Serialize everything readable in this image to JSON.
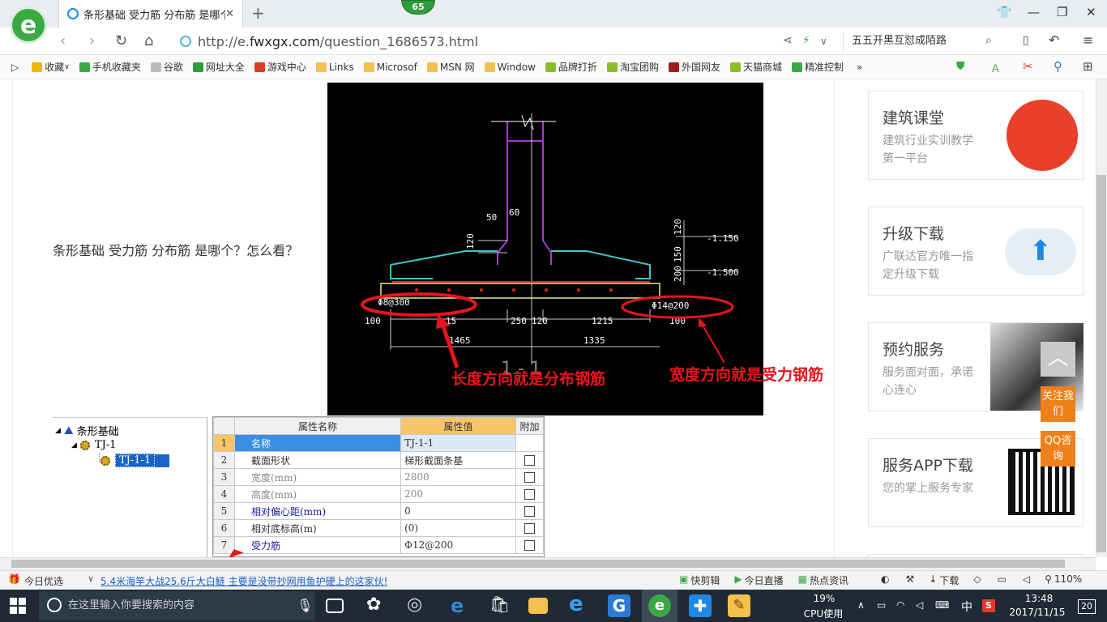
{
  "browser": {
    "tab_title": "条形基础 受力筋 分布筋 是哪个？怎",
    "tab_close": "✕",
    "new_tab": "+",
    "badge": "65",
    "url_prefix": "http://e.",
    "url_domain": "fwxgx.com",
    "url_path": "/question_1686573.html",
    "search_text": "五五开黑互怼成陌路",
    "logo": "e"
  },
  "bookmarks": [
    {
      "label": "收藏",
      "icon": "star-icon",
      "color": "#f0b400"
    },
    {
      "label": "手机收藏夹",
      "icon": "phone-icon",
      "color": "#3aa944"
    },
    {
      "label": "谷歌",
      "icon": "page-icon",
      "color": "#bbbbbb"
    },
    {
      "label": "网址大全",
      "icon": "globe-icon",
      "color": "#2e9b3c"
    },
    {
      "label": "游戏中心",
      "icon": "game-icon",
      "color": "#e03a2a"
    },
    {
      "label": "Links",
      "icon": "folder-icon",
      "color": "#f2c14e"
    },
    {
      "label": "Microsof",
      "icon": "folder-icon",
      "color": "#f2c14e"
    },
    {
      "label": "MSN 网",
      "icon": "folder-icon",
      "color": "#f2c14e"
    },
    {
      "label": "Window",
      "icon": "folder-icon",
      "color": "#f2c14e"
    },
    {
      "label": "品牌打折",
      "icon": "leaf-icon",
      "color": "#8bbf2a"
    },
    {
      "label": "淘宝团购",
      "icon": "leaf-icon",
      "color": "#8bbf2a"
    },
    {
      "label": "外国网友",
      "icon": "flag-icon",
      "color": "#a01a1a"
    },
    {
      "label": "天猫商城",
      "icon": "leaf-icon",
      "color": "#8bbf2a"
    },
    {
      "label": "精准控制",
      "icon": "chat-icon",
      "color": "#3aa944"
    }
  ],
  "question": "条形基础 受力筋 分布筋 是哪个？怎么看？",
  "annotations": {
    "length_dir": "长度方向就是分布钢筋",
    "width_dir": "宽度方向就是受力钢筋"
  },
  "cad_labels": {
    "rebar_left": "Φ8@300",
    "rebar_right": "Φ14@200",
    "elev1": "-1.150",
    "elev2": "-1.500",
    "dim_50": "50",
    "dim_60": "60",
    "dim_120": "120",
    "dim_250": "250",
    "dim_1215": "1215",
    "dim_1335": "1335",
    "dim_1465": "1465",
    "dim_100": "100",
    "dim_150": "150",
    "dim_200": "200",
    "dim_15": "15"
  },
  "tree": {
    "root": "条形基础",
    "child": "TJ-1",
    "leaf": "TJ-1-1"
  },
  "prop_table": {
    "headers": [
      "属性名称",
      "属性值",
      "附加"
    ],
    "rows": [
      {
        "n": "1",
        "name": "名称",
        "value": "TJ-1-1",
        "style": "blue",
        "check": false
      },
      {
        "n": "2",
        "name": "截面形状",
        "value": "梯形截面条基",
        "style": "",
        "check": true
      },
      {
        "n": "3",
        "name": "宽度(mm)",
        "value": "2800",
        "style": "gray",
        "check": true
      },
      {
        "n": "4",
        "name": "高度(mm)",
        "value": "200",
        "style": "gray",
        "check": true
      },
      {
        "n": "5",
        "name": "相对偏心距(mm)",
        "value": "0",
        "style": "blue",
        "check": true
      },
      {
        "n": "6",
        "name": "相对底标高(m)",
        "value": "(0)",
        "style": "",
        "check": true
      },
      {
        "n": "7",
        "name": "受力筋",
        "value": "Φ12@200",
        "style": "blue",
        "check": true
      }
    ]
  },
  "sidebar": [
    {
      "title": "建筑课堂",
      "sub": "建筑行业实训教学第一平台",
      "icon": "brand-swirl-icon"
    },
    {
      "title": "升级下载",
      "sub": "广联达官方唯一指定升级下载",
      "icon": "cloud-upload-icon"
    },
    {
      "title": "预约服务",
      "sub": "服务面对面，承诺心连心",
      "icon": "businessman-icon"
    },
    {
      "title": "服务APP下载",
      "sub": "您的掌上服务专家",
      "icon": "qr-code-icon"
    }
  ],
  "float": {
    "backtop": "︿",
    "follow": "关注我们",
    "qq": "QQ咨询"
  },
  "statusbar": {
    "today": "今日优选",
    "news": "5.4米海竿大战25.6斤大白鲢 主要是没带抄网用鱼护硬上的这家伙!",
    "items": [
      "快剪辑",
      "今日直播",
      "热点资讯",
      "下载"
    ],
    "zoom": "110%"
  },
  "taskbar": {
    "search_placeholder": "在这里输入你要搜索的内容",
    "cpu_pct": "19%",
    "cpu_label": "CPU使用",
    "ime": "中",
    "time": "13:48",
    "date": "2017/11/15",
    "notif": "20"
  }
}
